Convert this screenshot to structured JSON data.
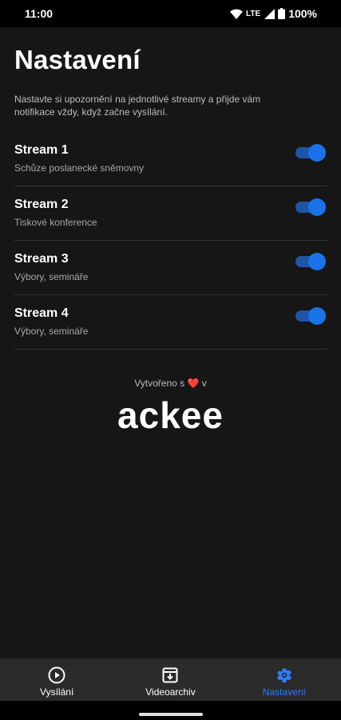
{
  "status_bar": {
    "time": "11:00",
    "network": "LTE",
    "battery": "100%",
    "icons": [
      "wifi-icon",
      "signal-icon",
      "battery-icon"
    ]
  },
  "page": {
    "title": "Nastavení",
    "intro": "Nastavte si upozornění na jednotlivé streamy a přijde vám notifikace vždy, když začne vysílání."
  },
  "streams": [
    {
      "name": "Stream 1",
      "description": "Schůze poslanecké sněmovny",
      "enabled": true
    },
    {
      "name": "Stream 2",
      "description": "Tiskové konference",
      "enabled": true
    },
    {
      "name": "Stream 3",
      "description": "Výbory, semináře",
      "enabled": true
    },
    {
      "name": "Stream 4",
      "description": "Výbory, semináře",
      "enabled": true
    }
  ],
  "credit": {
    "prefix": "Vytvořeno s",
    "heart": "❤️",
    "suffix": "v",
    "logo_text": "ackee"
  },
  "bottom_nav": [
    {
      "label": "Vysílání",
      "icon": "play-circle-icon",
      "active": false
    },
    {
      "label": "Videoarchiv",
      "icon": "archive-box-icon",
      "active": false
    },
    {
      "label": "Nastavení",
      "icon": "gear-icon",
      "active": true
    }
  ],
  "colors": {
    "accent": "#1a73e8",
    "background": "#161616",
    "nav_background": "#2b2b2b",
    "heart": "#e53935"
  }
}
